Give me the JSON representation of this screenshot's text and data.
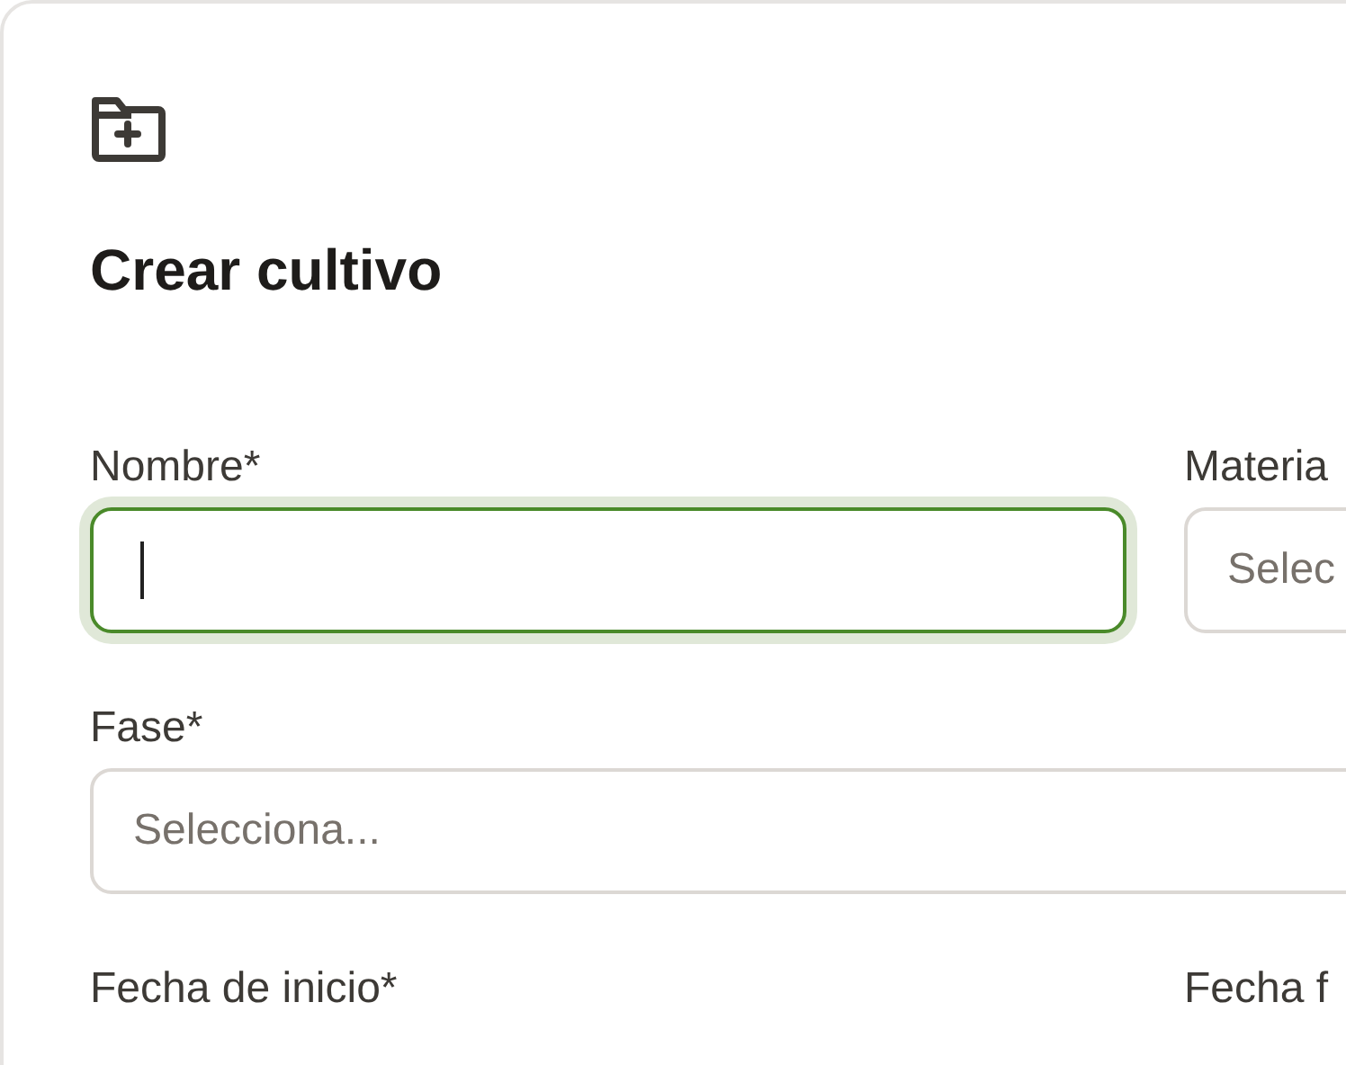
{
  "title": "Crear cultivo",
  "rows": [
    [
      {
        "label": "Nombre*",
        "kind": "text",
        "focused": true
      },
      {
        "label": "Materia",
        "kind": "select",
        "placeholder": "Selec",
        "focused": false
      }
    ],
    [
      {
        "label": "Fase*",
        "kind": "select",
        "placeholder": "Selecciona...",
        "focused": false
      }
    ],
    [
      {
        "label": "Fecha de inicio*"
      },
      {
        "label": "Fecha f"
      }
    ]
  ]
}
